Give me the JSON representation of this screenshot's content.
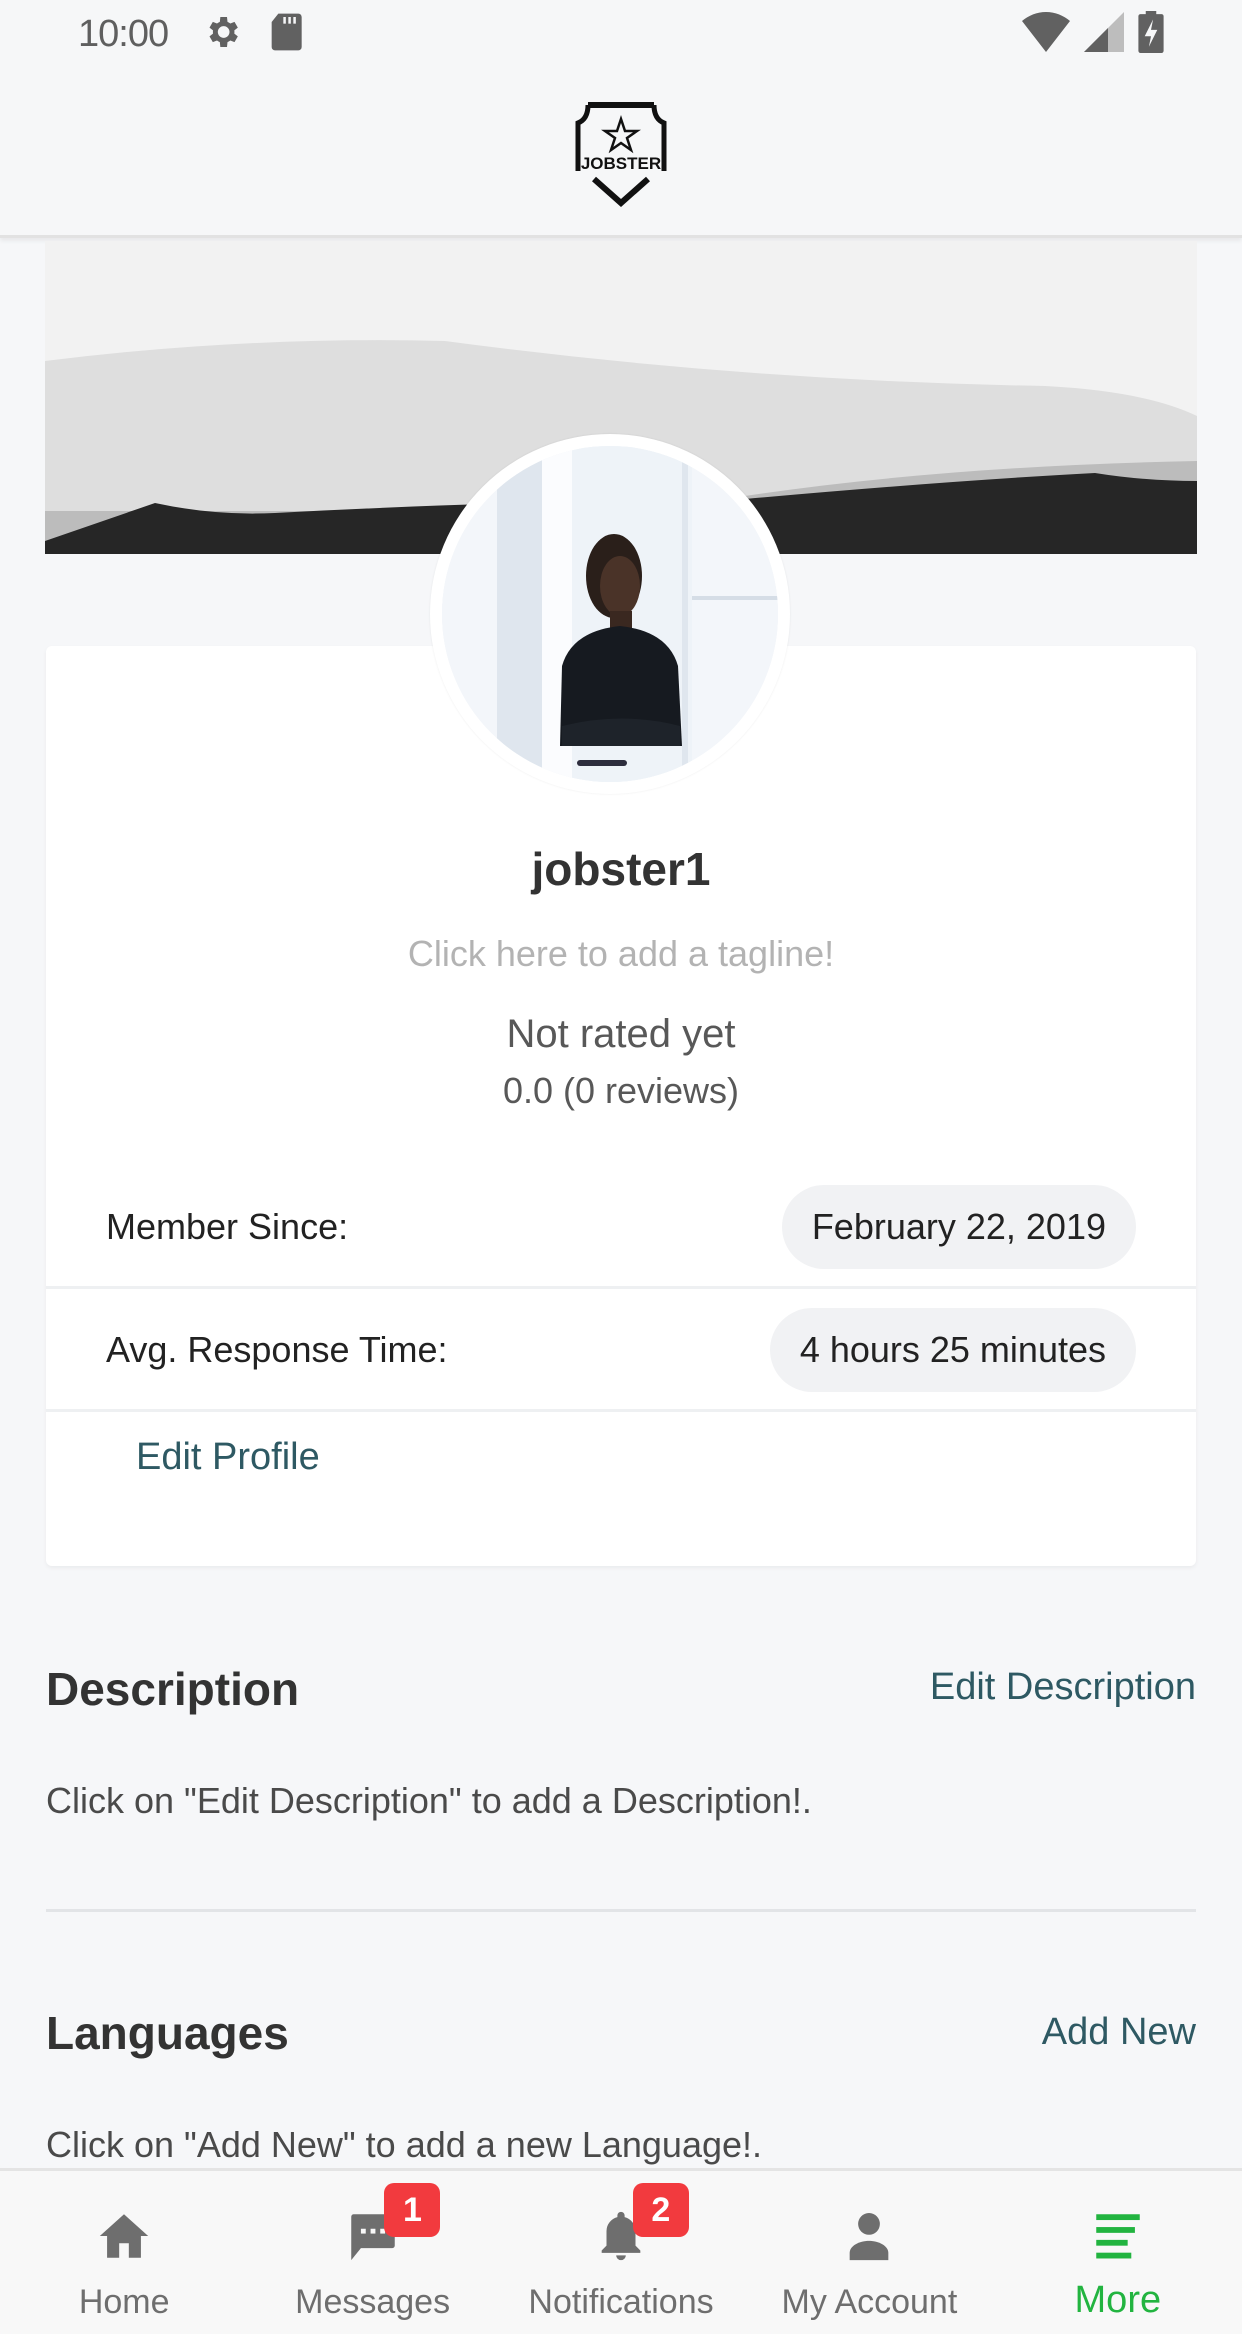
{
  "status_bar": {
    "time": "10:00",
    "icons": [
      "settings-icon",
      "sd-card-icon",
      "wifi-icon",
      "signal-icon",
      "battery-charging-icon"
    ]
  },
  "header": {
    "logo_text": "JOBSTER"
  },
  "profile": {
    "username": "jobster1",
    "tagline_placeholder": "Click here to add a tagline!",
    "rating_label": "Not rated yet",
    "rating_value": "0.0 (0 reviews)",
    "info": [
      {
        "label": "Member Since:",
        "value": "February 22, 2019"
      },
      {
        "label": "Avg. Response Time:",
        "value": "4 hours 25 minutes"
      }
    ],
    "edit_profile_label": "Edit Profile"
  },
  "description": {
    "title": "Description",
    "action_label": "Edit Description",
    "text": "Click on \"Edit Description\" to add a Description!."
  },
  "languages": {
    "title": "Languages",
    "action_label": "Add New",
    "text": "Click on \"Add New\" to add a new Language!."
  },
  "bottom_nav": {
    "items": [
      {
        "label": "Home",
        "icon": "home-icon",
        "badge": null,
        "active": false
      },
      {
        "label": "Messages",
        "icon": "chat-icon",
        "badge": "1",
        "active": false
      },
      {
        "label": "Notifications",
        "icon": "bell-icon",
        "badge": "2",
        "active": false
      },
      {
        "label": "My Account",
        "icon": "person-icon",
        "badge": null,
        "active": false
      },
      {
        "label": "More",
        "icon": "menu-icon",
        "badge": null,
        "active": true
      }
    ]
  },
  "colors": {
    "accent_green": "#22b440",
    "link_teal": "#2e5963",
    "badge_red": "#f23a3e",
    "background": "#f6f7f9"
  }
}
